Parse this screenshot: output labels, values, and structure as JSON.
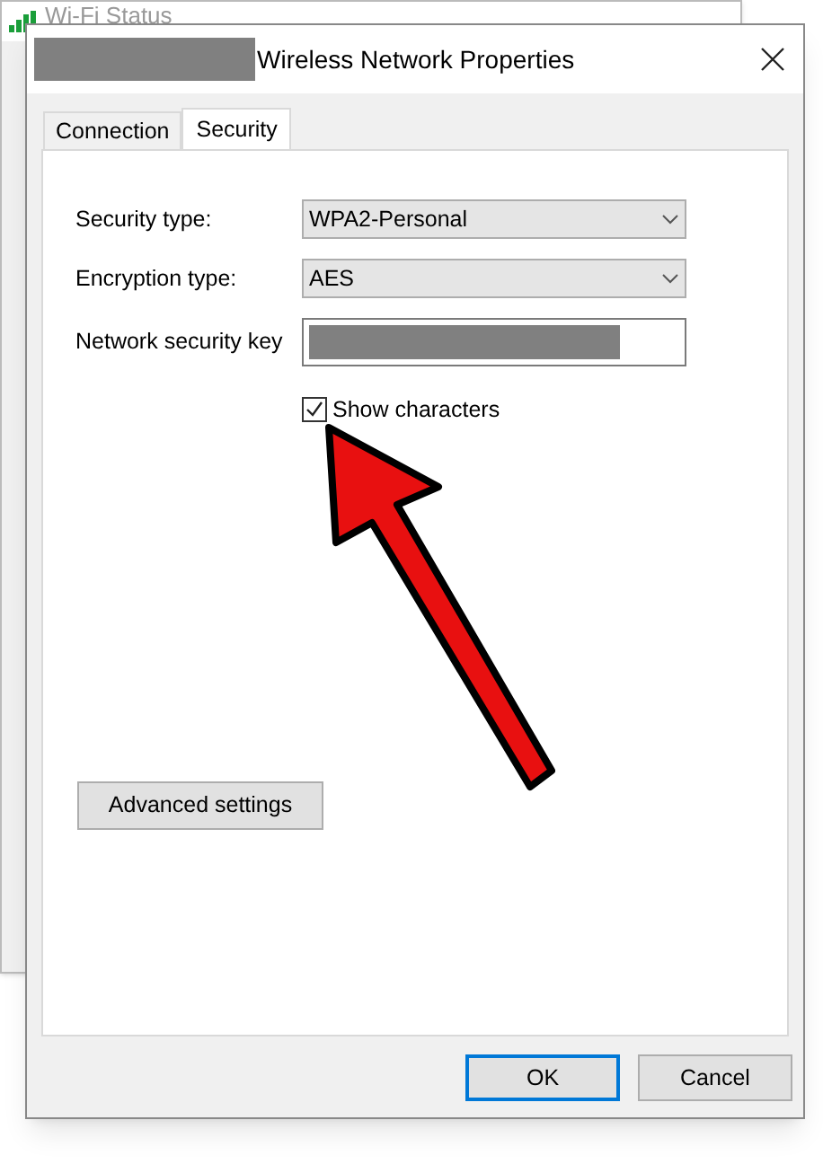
{
  "background_window": {
    "title": "Wi-Fi Status"
  },
  "dialog": {
    "title": "Wireless Network Properties",
    "title_redacted": true
  },
  "tabs": [
    {
      "label": "Connection",
      "selected": false
    },
    {
      "label": "Security",
      "selected": true
    }
  ],
  "fields": [
    {
      "kind": "dropdown",
      "label": "Security type:",
      "value": "WPA2-Personal"
    },
    {
      "kind": "dropdown",
      "label": "Encryption type:",
      "value": "AES"
    },
    {
      "kind": "key",
      "label": "Network security key",
      "redacted": true
    }
  ],
  "show_characters": {
    "label": "Show characters",
    "checked": true
  },
  "annotation": {
    "kind": "arrow"
  },
  "advanced_button": "Advanced settings",
  "buttons": [
    {
      "label": "OK",
      "default": true
    },
    {
      "label": "Cancel",
      "default": false
    }
  ]
}
